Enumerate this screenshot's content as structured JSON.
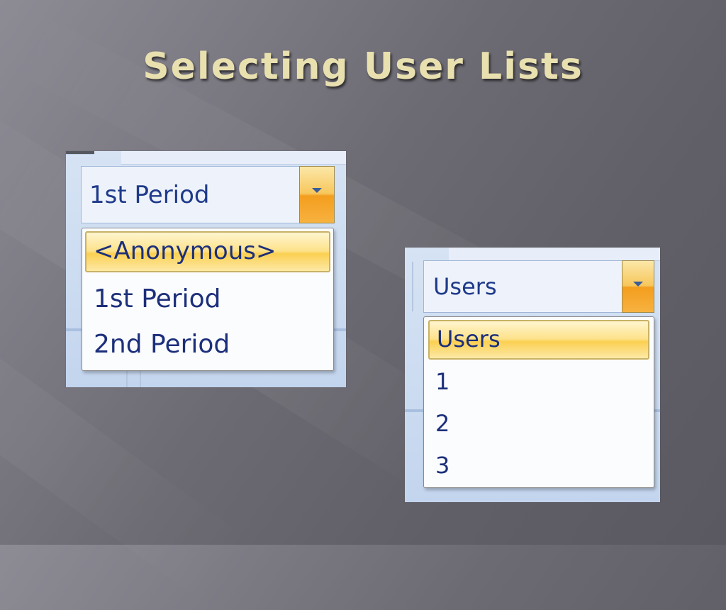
{
  "slide": {
    "title": "Selecting User Lists"
  },
  "period_selector": {
    "selected_value": "1st Period",
    "options": [
      {
        "label": "<Anonymous>",
        "selected": true
      },
      {
        "label": "1st Period",
        "selected": false
      },
      {
        "label": "2nd Period",
        "selected": false
      }
    ]
  },
  "users_selector": {
    "selected_value": "Users",
    "options": [
      {
        "label": "Users",
        "selected": true
      },
      {
        "label": "1",
        "selected": false
      },
      {
        "label": "2",
        "selected": false
      },
      {
        "label": "3",
        "selected": false
      }
    ]
  },
  "colors": {
    "title_text": "#e9e0b0",
    "option_text": "#1c2f7a",
    "highlight": "#fbd052",
    "combo_button": "#f39e1e"
  },
  "icons": {
    "dropdown_arrow": "chevron-down-icon"
  }
}
